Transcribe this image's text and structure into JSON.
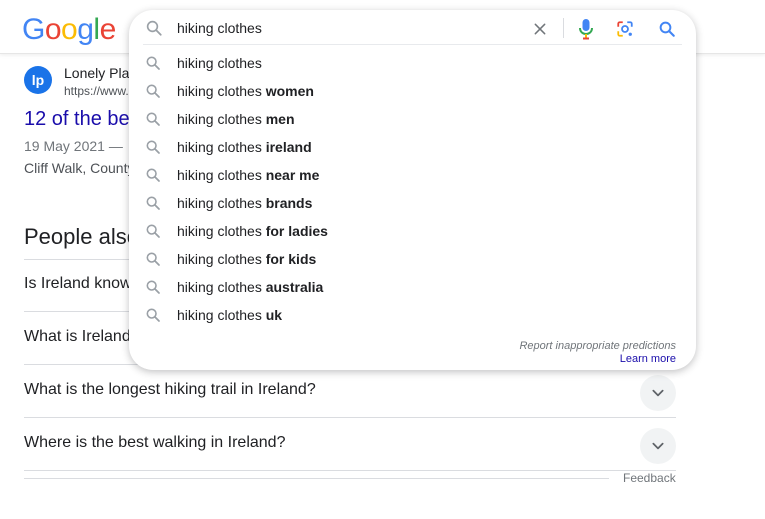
{
  "header": {
    "logo_letters": [
      {
        "ch": "G",
        "color": "#4285F4"
      },
      {
        "ch": "o",
        "color": "#EA4335"
      },
      {
        "ch": "o",
        "color": "#FBBC05"
      },
      {
        "ch": "g",
        "color": "#4285F4"
      },
      {
        "ch": "l",
        "color": "#34A853"
      },
      {
        "ch": "e",
        "color": "#EA4335"
      }
    ]
  },
  "search": {
    "value": "hiking clothes",
    "icons": {
      "search": "search-icon",
      "clear": "close-icon",
      "mic": "microphone-icon",
      "lens": "lens-icon",
      "submit": "search-icon"
    },
    "suggestions": [
      {
        "prefix": "hiking clothes",
        "suffix": ""
      },
      {
        "prefix": "hiking clothes ",
        "suffix": "women"
      },
      {
        "prefix": "hiking clothes ",
        "suffix": "men"
      },
      {
        "prefix": "hiking clothes ",
        "suffix": "ireland"
      },
      {
        "prefix": "hiking clothes ",
        "suffix": "near me"
      },
      {
        "prefix": "hiking clothes ",
        "suffix": "brands"
      },
      {
        "prefix": "hiking clothes ",
        "suffix": "for ladies"
      },
      {
        "prefix": "hiking clothes ",
        "suffix": "for kids"
      },
      {
        "prefix": "hiking clothes ",
        "suffix": "australia"
      },
      {
        "prefix": "hiking clothes ",
        "suffix": "uk"
      }
    ],
    "report_label": "Report inappropriate predictions",
    "learn_more_label": "Learn more"
  },
  "result": {
    "favicon_text": "lp",
    "site_name": "Lonely Pla",
    "url": "https://www.",
    "title": "12 of the be",
    "date": "19 May 2021 — ",
    "snippet": "Cliff Walk, County"
  },
  "people_also_ask": {
    "heading": "People also",
    "questions": [
      "Is Ireland know",
      "What is Ireland",
      "What is the longest hiking trail in Ireland?",
      "Where is the best walking in Ireland?"
    ]
  },
  "footer": {
    "feedback_label": "Feedback"
  },
  "colors": {
    "link": "#1a0dab",
    "accent_blue": "#4285F4",
    "text": "#202124",
    "muted": "#70757a"
  }
}
